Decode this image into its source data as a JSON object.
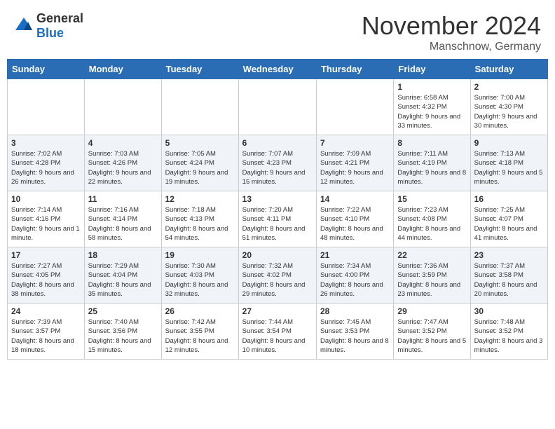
{
  "header": {
    "logo_general": "General",
    "logo_blue": "Blue",
    "month_title": "November 2024",
    "location": "Manschnow, Germany"
  },
  "weekdays": [
    "Sunday",
    "Monday",
    "Tuesday",
    "Wednesday",
    "Thursday",
    "Friday",
    "Saturday"
  ],
  "weeks": [
    [
      {
        "day": "",
        "info": ""
      },
      {
        "day": "",
        "info": ""
      },
      {
        "day": "",
        "info": ""
      },
      {
        "day": "",
        "info": ""
      },
      {
        "day": "",
        "info": ""
      },
      {
        "day": "1",
        "info": "Sunrise: 6:58 AM\nSunset: 4:32 PM\nDaylight: 9 hours and 33 minutes."
      },
      {
        "day": "2",
        "info": "Sunrise: 7:00 AM\nSunset: 4:30 PM\nDaylight: 9 hours and 30 minutes."
      }
    ],
    [
      {
        "day": "3",
        "info": "Sunrise: 7:02 AM\nSunset: 4:28 PM\nDaylight: 9 hours and 26 minutes."
      },
      {
        "day": "4",
        "info": "Sunrise: 7:03 AM\nSunset: 4:26 PM\nDaylight: 9 hours and 22 minutes."
      },
      {
        "day": "5",
        "info": "Sunrise: 7:05 AM\nSunset: 4:24 PM\nDaylight: 9 hours and 19 minutes."
      },
      {
        "day": "6",
        "info": "Sunrise: 7:07 AM\nSunset: 4:23 PM\nDaylight: 9 hours and 15 minutes."
      },
      {
        "day": "7",
        "info": "Sunrise: 7:09 AM\nSunset: 4:21 PM\nDaylight: 9 hours and 12 minutes."
      },
      {
        "day": "8",
        "info": "Sunrise: 7:11 AM\nSunset: 4:19 PM\nDaylight: 9 hours and 8 minutes."
      },
      {
        "day": "9",
        "info": "Sunrise: 7:13 AM\nSunset: 4:18 PM\nDaylight: 9 hours and 5 minutes."
      }
    ],
    [
      {
        "day": "10",
        "info": "Sunrise: 7:14 AM\nSunset: 4:16 PM\nDaylight: 9 hours and 1 minute."
      },
      {
        "day": "11",
        "info": "Sunrise: 7:16 AM\nSunset: 4:14 PM\nDaylight: 8 hours and 58 minutes."
      },
      {
        "day": "12",
        "info": "Sunrise: 7:18 AM\nSunset: 4:13 PM\nDaylight: 8 hours and 54 minutes."
      },
      {
        "day": "13",
        "info": "Sunrise: 7:20 AM\nSunset: 4:11 PM\nDaylight: 8 hours and 51 minutes."
      },
      {
        "day": "14",
        "info": "Sunrise: 7:22 AM\nSunset: 4:10 PM\nDaylight: 8 hours and 48 minutes."
      },
      {
        "day": "15",
        "info": "Sunrise: 7:23 AM\nSunset: 4:08 PM\nDaylight: 8 hours and 44 minutes."
      },
      {
        "day": "16",
        "info": "Sunrise: 7:25 AM\nSunset: 4:07 PM\nDaylight: 8 hours and 41 minutes."
      }
    ],
    [
      {
        "day": "17",
        "info": "Sunrise: 7:27 AM\nSunset: 4:05 PM\nDaylight: 8 hours and 38 minutes."
      },
      {
        "day": "18",
        "info": "Sunrise: 7:29 AM\nSunset: 4:04 PM\nDaylight: 8 hours and 35 minutes."
      },
      {
        "day": "19",
        "info": "Sunrise: 7:30 AM\nSunset: 4:03 PM\nDaylight: 8 hours and 32 minutes."
      },
      {
        "day": "20",
        "info": "Sunrise: 7:32 AM\nSunset: 4:02 PM\nDaylight: 8 hours and 29 minutes."
      },
      {
        "day": "21",
        "info": "Sunrise: 7:34 AM\nSunset: 4:00 PM\nDaylight: 8 hours and 26 minutes."
      },
      {
        "day": "22",
        "info": "Sunrise: 7:36 AM\nSunset: 3:59 PM\nDaylight: 8 hours and 23 minutes."
      },
      {
        "day": "23",
        "info": "Sunrise: 7:37 AM\nSunset: 3:58 PM\nDaylight: 8 hours and 20 minutes."
      }
    ],
    [
      {
        "day": "24",
        "info": "Sunrise: 7:39 AM\nSunset: 3:57 PM\nDaylight: 8 hours and 18 minutes."
      },
      {
        "day": "25",
        "info": "Sunrise: 7:40 AM\nSunset: 3:56 PM\nDaylight: 8 hours and 15 minutes."
      },
      {
        "day": "26",
        "info": "Sunrise: 7:42 AM\nSunset: 3:55 PM\nDaylight: 8 hours and 12 minutes."
      },
      {
        "day": "27",
        "info": "Sunrise: 7:44 AM\nSunset: 3:54 PM\nDaylight: 8 hours and 10 minutes."
      },
      {
        "day": "28",
        "info": "Sunrise: 7:45 AM\nSunset: 3:53 PM\nDaylight: 8 hours and 8 minutes."
      },
      {
        "day": "29",
        "info": "Sunrise: 7:47 AM\nSunset: 3:52 PM\nDaylight: 8 hours and 5 minutes."
      },
      {
        "day": "30",
        "info": "Sunrise: 7:48 AM\nSunset: 3:52 PM\nDaylight: 8 hours and 3 minutes."
      }
    ]
  ]
}
